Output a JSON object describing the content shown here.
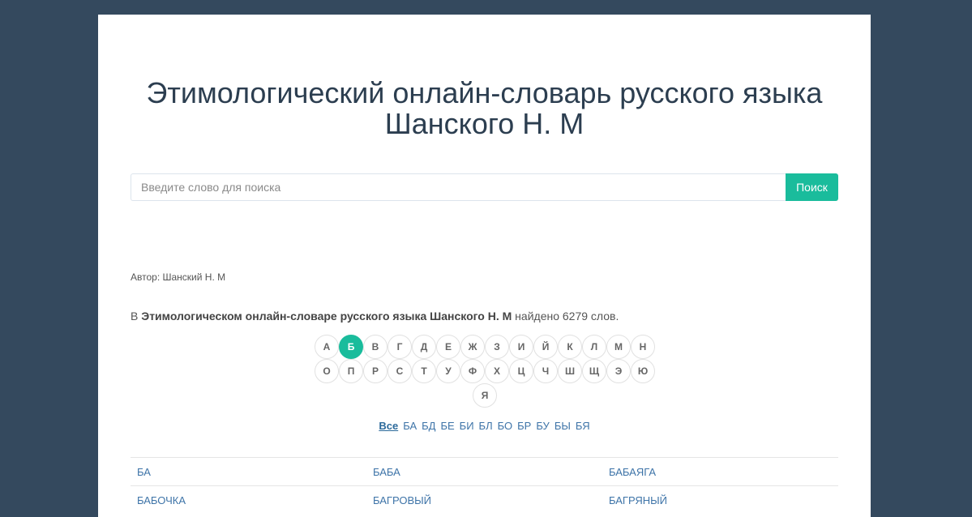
{
  "header": {
    "title_line1": "Этимологический онлайн-словарь русского языка",
    "title_line2": "Шанского Н. М"
  },
  "search": {
    "placeholder": "Введите слово для поиска",
    "value": "",
    "button_label": "Поиск"
  },
  "author": "Автор: Шанский Н. М",
  "summary": {
    "prefix": "В ",
    "dictionary_name": "Этимологическом онлайн-словаре русского языка Шанского Н. М",
    "suffix": " найдено 6279 слов."
  },
  "alphabet": {
    "active": "Б",
    "rows": [
      [
        "А",
        "Б",
        "В",
        "Г",
        "Д",
        "Е",
        "Ж",
        "З",
        "И",
        "Й",
        "К",
        "Л",
        "М",
        "Н"
      ],
      [
        "О",
        "П",
        "Р",
        "С",
        "Т",
        "У",
        "Ф",
        "Х",
        "Ц",
        "Ч",
        "Ш",
        "Щ",
        "Э",
        "Ю"
      ],
      [
        "Я"
      ]
    ]
  },
  "syllables": {
    "active": "Все",
    "items": [
      "Все",
      "БА",
      "БД",
      "БЕ",
      "БИ",
      "БЛ",
      "БО",
      "БР",
      "БУ",
      "БЫ",
      "БЯ"
    ]
  },
  "words": [
    [
      "БА",
      "БАБА",
      "БАБАЯГА"
    ],
    [
      "БАБОЧКА",
      "БАГРОВЫЙ",
      "БАГРЯНЫЙ"
    ]
  ],
  "colors": {
    "background": "#34495e",
    "accent": "#1abc9c",
    "link": "#3e74a8",
    "title": "#2c3e50"
  }
}
